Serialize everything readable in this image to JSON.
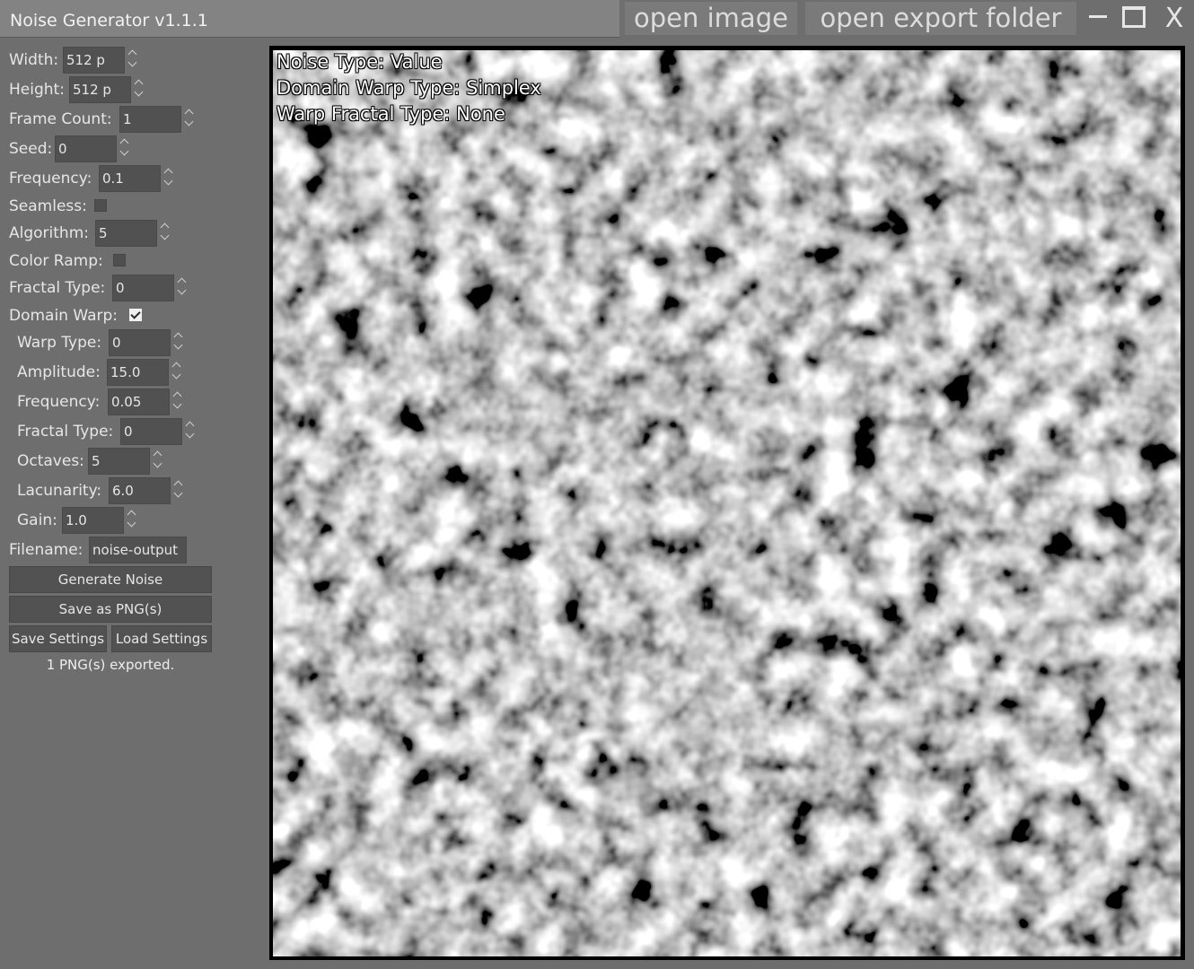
{
  "app": {
    "title": "Noise Generator v1.1.1",
    "open_image": "open image",
    "open_export_folder": "open export folder",
    "close_glyph": "X"
  },
  "settings": {
    "width": {
      "label": "Width:",
      "value": "512 p"
    },
    "height": {
      "label": "Height:",
      "value": "512 p"
    },
    "frame_count": {
      "label": "Frame Count:",
      "value": "1"
    },
    "seed": {
      "label": "Seed:",
      "value": "0"
    },
    "frequency": {
      "label": "Frequency:",
      "value": "0.1"
    },
    "seamless": {
      "label": "Seamless:",
      "checked": false
    },
    "algorithm": {
      "label": "Algorithm:",
      "value": "5"
    },
    "color_ramp": {
      "label": "Color Ramp:",
      "checked": false
    },
    "fractal_type": {
      "label": "Fractal Type:",
      "value": "0"
    },
    "domain_warp": {
      "label": "Domain Warp:",
      "checked": true
    }
  },
  "warp": {
    "warp_type": {
      "label": "Warp Type:",
      "value": "0"
    },
    "amplitude": {
      "label": "Amplitude:",
      "value": "15.0"
    },
    "frequency": {
      "label": "Frequency:",
      "value": "0.05"
    },
    "fractal_type": {
      "label": "Fractal Type:",
      "value": "0"
    },
    "octaves": {
      "label": "Octaves:",
      "value": "5"
    },
    "lacunarity": {
      "label": "Lacunarity:",
      "value": "6.0"
    },
    "gain": {
      "label": "Gain:",
      "value": "1.0"
    }
  },
  "filename": {
    "label": "Filename:",
    "value": "noise-output"
  },
  "buttons": {
    "generate": "Generate Noise",
    "save_png": "Save as PNG(s)",
    "save_settings": "Save Settings",
    "load_settings": "Load Settings"
  },
  "status": "1 PNG(s) exported.",
  "preview": {
    "noise_type": "Noise Type: Value",
    "domain_warp_type": "Domain Warp Type: Simplex",
    "warp_fractal_type": "Warp Fractal Type: None"
  },
  "colors": {
    "background": "#6e6e6e",
    "title_bar": "#838383",
    "field": "#515151",
    "text": "#e6e6e6"
  }
}
